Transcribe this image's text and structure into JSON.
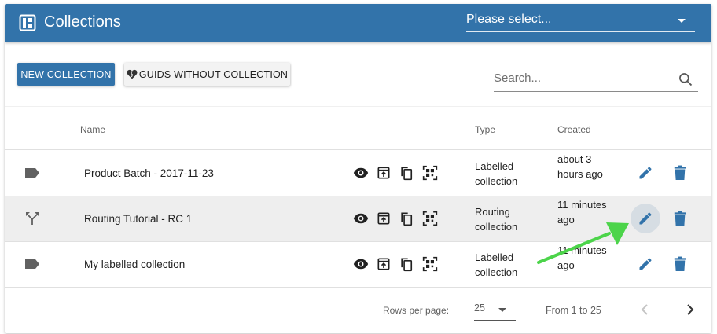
{
  "appbar": {
    "title": "Collections",
    "select_placeholder": "Please select..."
  },
  "toolbar": {
    "new_collection_label": "NEW COLLECTION",
    "guids_without_collection_label": "GUIDS WITHOUT COLLECTION",
    "search_placeholder": "Search..."
  },
  "table": {
    "columns": [
      "Name",
      "Type",
      "Created"
    ],
    "rows": [
      {
        "icon": "label-icon",
        "name": "Product Batch - 2017-11-23",
        "type": "Labelled collection",
        "created": "about 3 hours ago",
        "highlighted": false
      },
      {
        "icon": "routing-icon",
        "name": "Routing Tutorial - RC 1",
        "type": "Routing collection",
        "created": "11 minutes ago",
        "highlighted": true
      },
      {
        "icon": "label-icon",
        "name": "My labelled collection",
        "type": "Labelled collection",
        "created": "11 minutes ago",
        "highlighted": false
      }
    ],
    "row_actions": [
      "view-icon",
      "open-in-new-icon",
      "copy-icon",
      "qr-code-icon",
      "edit-icon",
      "delete-icon"
    ]
  },
  "pagination": {
    "rows_per_page_label": "Rows per page:",
    "rows_per_page_value": "25",
    "range_text": "From 1 to 25"
  },
  "colors": {
    "primary": "#3273aa",
    "annotation_arrow": "#4cd44a",
    "row_highlight": "#eeeeee"
  }
}
